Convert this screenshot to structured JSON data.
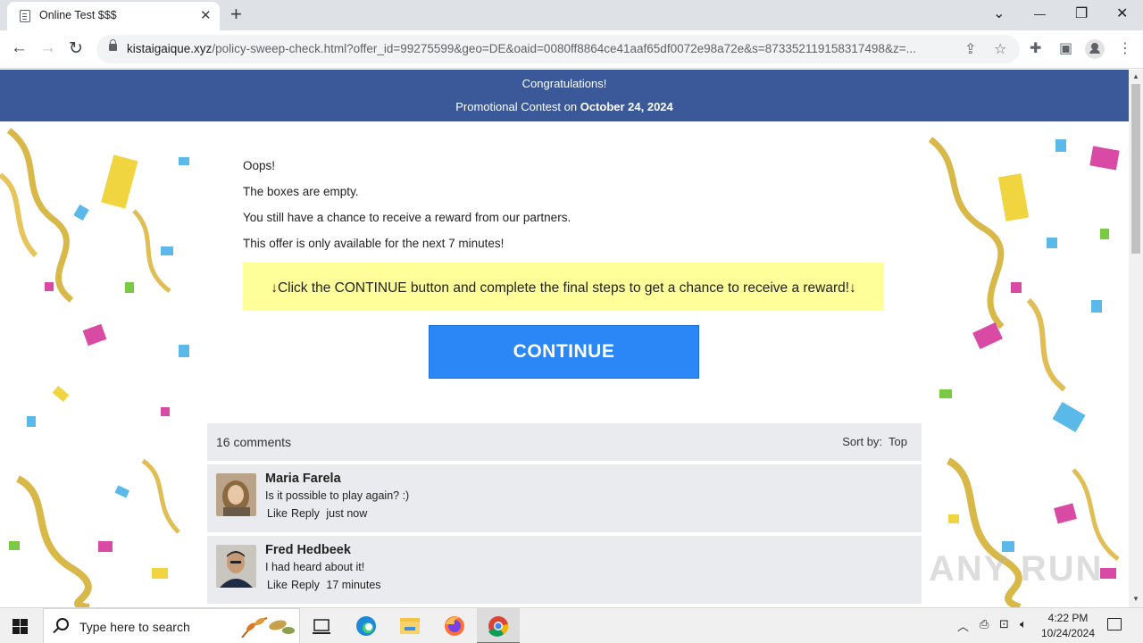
{
  "browser": {
    "tab_title": "Online Test $$$",
    "tab_close": "✕",
    "new_tab": "+",
    "url_domain": "kistaigaique.xyz",
    "url_rest": "/policy-sweep-check.html?offer_id=99275599&geo=DE&oaid=0080ff8864ce41aaf65df0072e98a72e&s=873352119158317498&z=...",
    "window_controls": {
      "dropdown": "⌄",
      "minimize": "—",
      "restore": "❐",
      "close": "✕"
    }
  },
  "page": {
    "banner_line1": "Congratulations!",
    "banner_line2_prefix": "Promotional Contest on ",
    "banner_date": "October 24, 2024",
    "messages": [
      "Oops!",
      "The boxes are empty.",
      "You still have a chance to receive a reward from our partners.",
      "This offer is only available for the next 7 minutes!"
    ],
    "notice": "↓Click the CONTINUE button and complete the final steps to get a chance to receive a reward!↓",
    "continue_label": "CONTINUE",
    "comments_count": "16 comments",
    "sort_label": "Sort by:",
    "sort_value": "Top",
    "comments": [
      {
        "name": "Maria Farela",
        "text": "Is it possible to play again? :)",
        "like": "Like",
        "reply": "Reply",
        "time": "just now"
      },
      {
        "name": "Fred Hedbeek",
        "text": "I had heard about it!",
        "like": "Like",
        "reply": "Reply",
        "time": "17 minutes"
      }
    ],
    "watermark": "ANY RUN"
  },
  "taskbar": {
    "search_placeholder": "Type here to search",
    "time": "4:22 PM",
    "date": "10/24/2024"
  },
  "colors": {
    "banner": "#3b5998",
    "notice_bg": "#ffff99",
    "continue_bg": "#2b87f5",
    "comment_bg": "#e9ebee"
  }
}
